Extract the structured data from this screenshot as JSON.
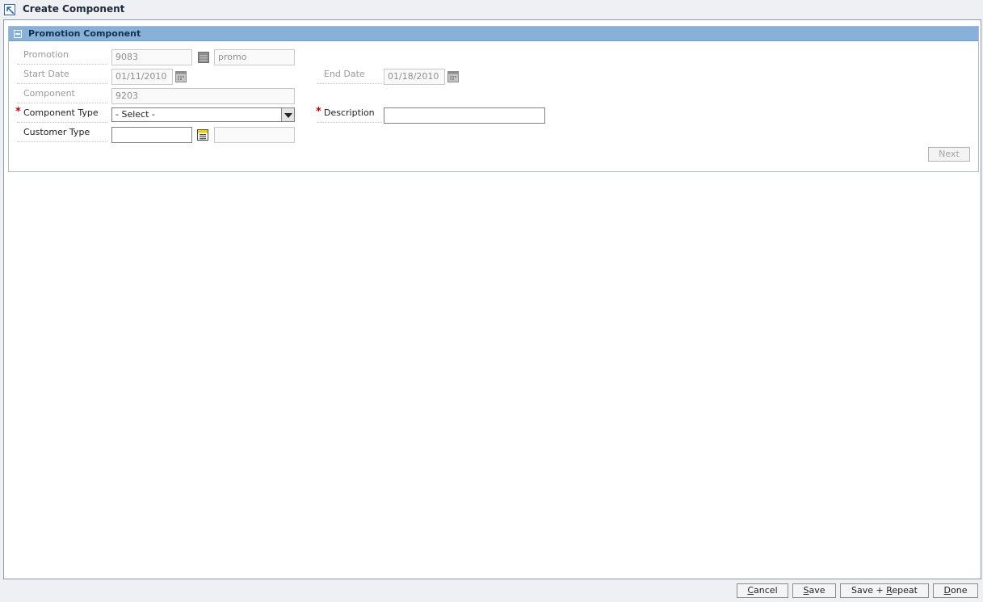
{
  "window": {
    "title": "Create Component",
    "title_icon": "arrow-up-left-icon"
  },
  "panel": {
    "title": "Promotion Component",
    "collapse_icon": "collapse-minus-icon"
  },
  "form": {
    "promotion": {
      "label": "Promotion",
      "value": "9083",
      "description": "promo"
    },
    "start_date": {
      "label": "Start Date",
      "value": "01/11/2010"
    },
    "end_date": {
      "label": "End Date",
      "value": "01/18/2010"
    },
    "component": {
      "label": "Component",
      "value": "9203"
    },
    "component_type": {
      "label": "Component Type",
      "selected": "- Select -",
      "required": "*"
    },
    "description": {
      "label": "Description",
      "value": "",
      "required": "*"
    },
    "customer_type": {
      "label": "Customer Type",
      "value": "",
      "description": ""
    }
  },
  "buttons": {
    "next": "Next",
    "cancel": {
      "pre": "",
      "ul": "C",
      "post": "ancel"
    },
    "save": {
      "pre": "",
      "ul": "S",
      "post": "ave"
    },
    "save_repeat": {
      "pre": "Save + ",
      "ul": "R",
      "post": "epeat"
    },
    "done": {
      "pre": "",
      "ul": "D",
      "post": "one"
    }
  }
}
